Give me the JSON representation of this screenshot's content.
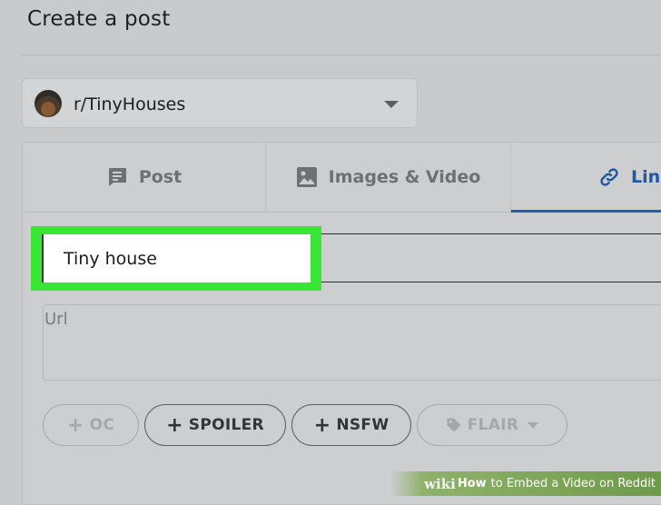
{
  "header": {
    "title": "Create a post"
  },
  "community": {
    "name": "r/TinyHouses"
  },
  "tabs": [
    {
      "label": "Post",
      "icon": "post-icon"
    },
    {
      "label": "Images & Video",
      "icon": "image-icon"
    },
    {
      "label": "Link",
      "icon": "link-icon",
      "active": true
    }
  ],
  "form": {
    "title_value": "Tiny house",
    "url_placeholder": "Url"
  },
  "tags": {
    "oc": "OC",
    "spoiler": "SPOILER",
    "nsfw": "NSFW",
    "flair": "FLAIR"
  },
  "watermark": {
    "brand": "wiki",
    "how": "How",
    "rest": "to Embed a Video on Reddit"
  },
  "colors": {
    "highlight": "#39e635",
    "link_accent": "#1f57a3",
    "background": "#c9cacb"
  }
}
